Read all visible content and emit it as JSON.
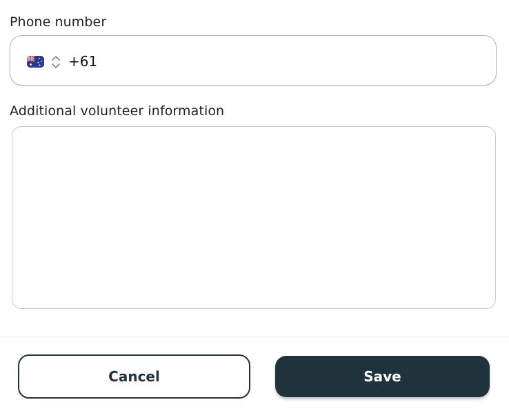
{
  "form": {
    "phone": {
      "label": "Phone number",
      "country_flag": "australia-flag-icon",
      "dial_code": "+61"
    },
    "additional_info": {
      "label": "Additional volunteer information",
      "value": ""
    }
  },
  "actions": {
    "cancel_label": "Cancel",
    "save_label": "Save"
  },
  "colors": {
    "primary_dark": "#1f333c",
    "border": "#b9b9b9"
  }
}
